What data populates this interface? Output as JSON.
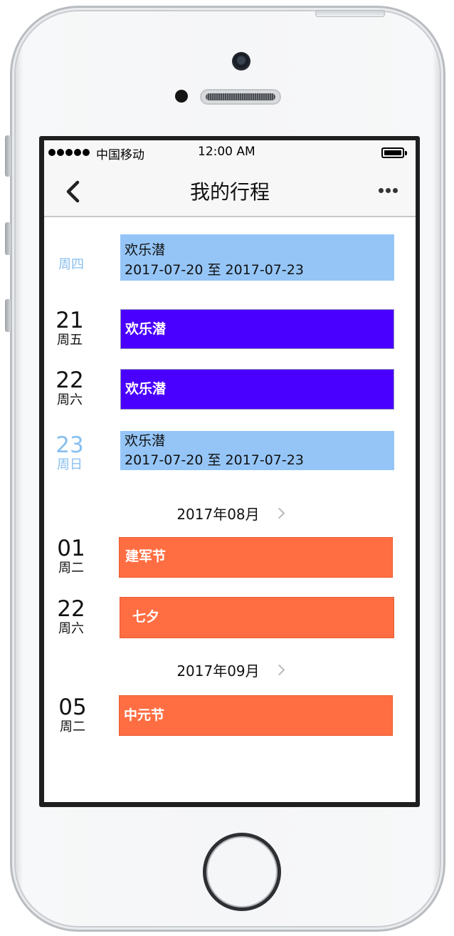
{
  "status_bar": {
    "carrier": "中国移动",
    "time": "12:00 AM"
  },
  "nav": {
    "title": "我的行程"
  },
  "schedule": {
    "days": [
      {
        "day": "",
        "weekday": "周四",
        "event_title": "欢乐潜",
        "event_range": "2017-07-20  至   2017-07-23"
      },
      {
        "day": "21",
        "weekday": "周五",
        "event_title": "欢乐潜"
      },
      {
        "day": "22",
        "weekday": "周六",
        "event_title": "欢乐潜"
      },
      {
        "day": "23",
        "weekday": "周日",
        "event_title": "欢乐潜",
        "event_range": "2017-07-20  至  2017-07-23"
      }
    ],
    "months": [
      {
        "label": "2017年08月",
        "days": [
          {
            "day": "01",
            "weekday": "周二",
            "event_title": "建军节"
          },
          {
            "day": "22",
            "weekday": "周六",
            "event_title": "七夕"
          }
        ]
      },
      {
        "label": "2017年09月",
        "days": [
          {
            "day": "05",
            "weekday": "周二",
            "event_title": "中元节"
          }
        ]
      }
    ]
  },
  "colors": {
    "multi_day_event": "#95c5f7",
    "single_event": "#4a00ff",
    "holiday_event": "#ff6e42",
    "past_date_text": "#87bff0"
  }
}
